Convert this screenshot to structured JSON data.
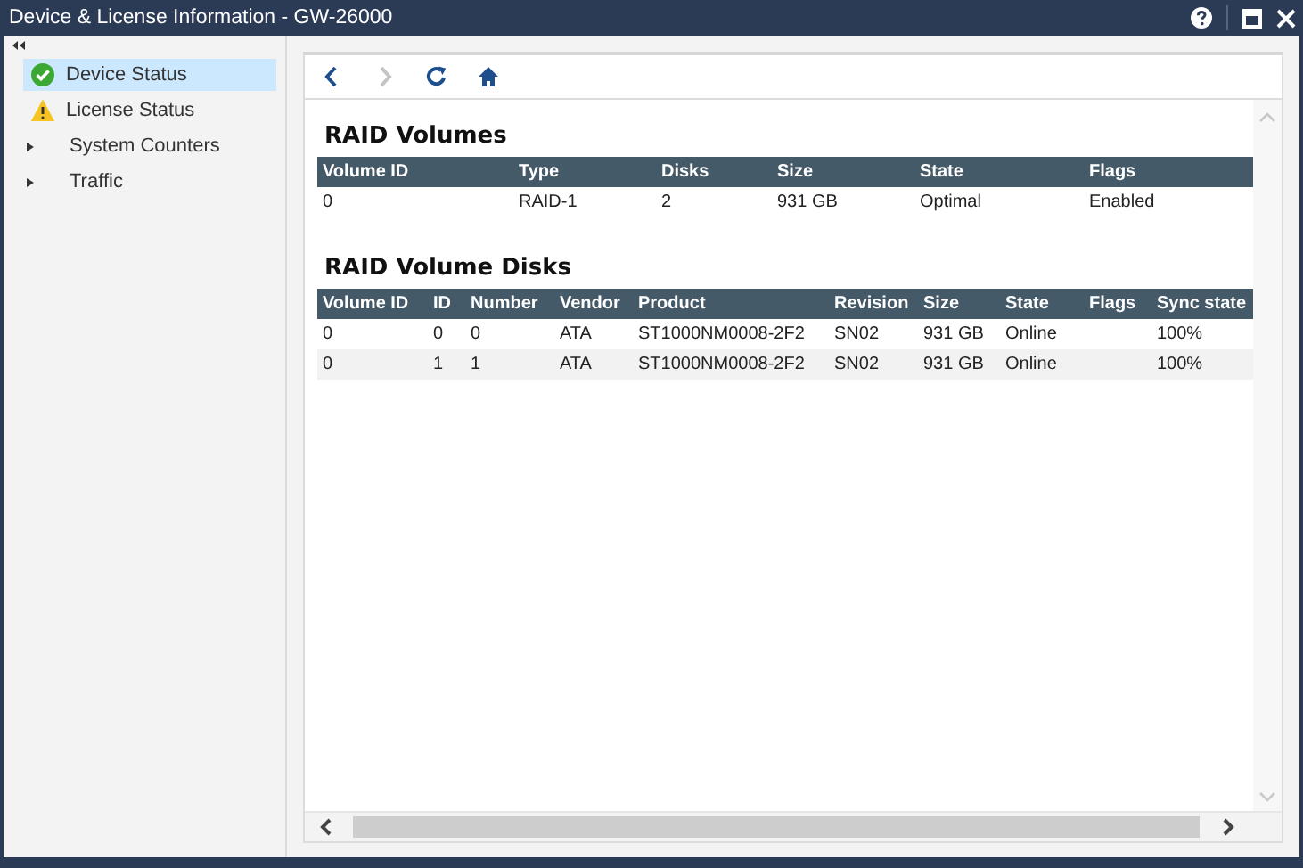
{
  "window": {
    "title": "Device & License Information - GW-26000"
  },
  "sidebar": {
    "items": [
      {
        "label": "Device Status",
        "kind": "ok",
        "selected": true
      },
      {
        "label": "License Status",
        "kind": "warning",
        "selected": false
      },
      {
        "label": "System Counters",
        "kind": "group",
        "expanded": false,
        "selected": false
      },
      {
        "label": "Traffic",
        "kind": "group",
        "expanded": false,
        "selected": false
      }
    ]
  },
  "toolbar": [
    {
      "kind": "back",
      "disabled": false
    },
    {
      "kind": "forward",
      "disabled": true
    },
    {
      "kind": "refresh",
      "disabled": false
    },
    {
      "kind": "home",
      "disabled": false
    }
  ],
  "sections": [
    {
      "title": "RAID Volumes",
      "columns": [
        "Volume ID",
        "Type",
        "Disks",
        "Size",
        "State",
        "Flags"
      ],
      "rows": [
        [
          "0",
          "RAID-1",
          "2",
          "931 GB",
          "Optimal",
          "Enabled"
        ]
      ]
    },
    {
      "title": "RAID Volume Disks",
      "columns": [
        "Volume ID",
        "ID",
        "Number",
        "Vendor",
        "Product",
        "Revision",
        "Size",
        "State",
        "Flags",
        "Sync state"
      ],
      "rows": [
        [
          "0",
          "0",
          "0",
          "ATA",
          "ST1000NM0008-2F2",
          "SN02",
          "931 GB",
          "Online",
          "",
          "100%"
        ],
        [
          "0",
          "1",
          "1",
          "ATA",
          "ST1000NM0008-2F2",
          "SN02",
          "931 GB",
          "Online",
          "",
          "100%"
        ]
      ]
    }
  ]
}
